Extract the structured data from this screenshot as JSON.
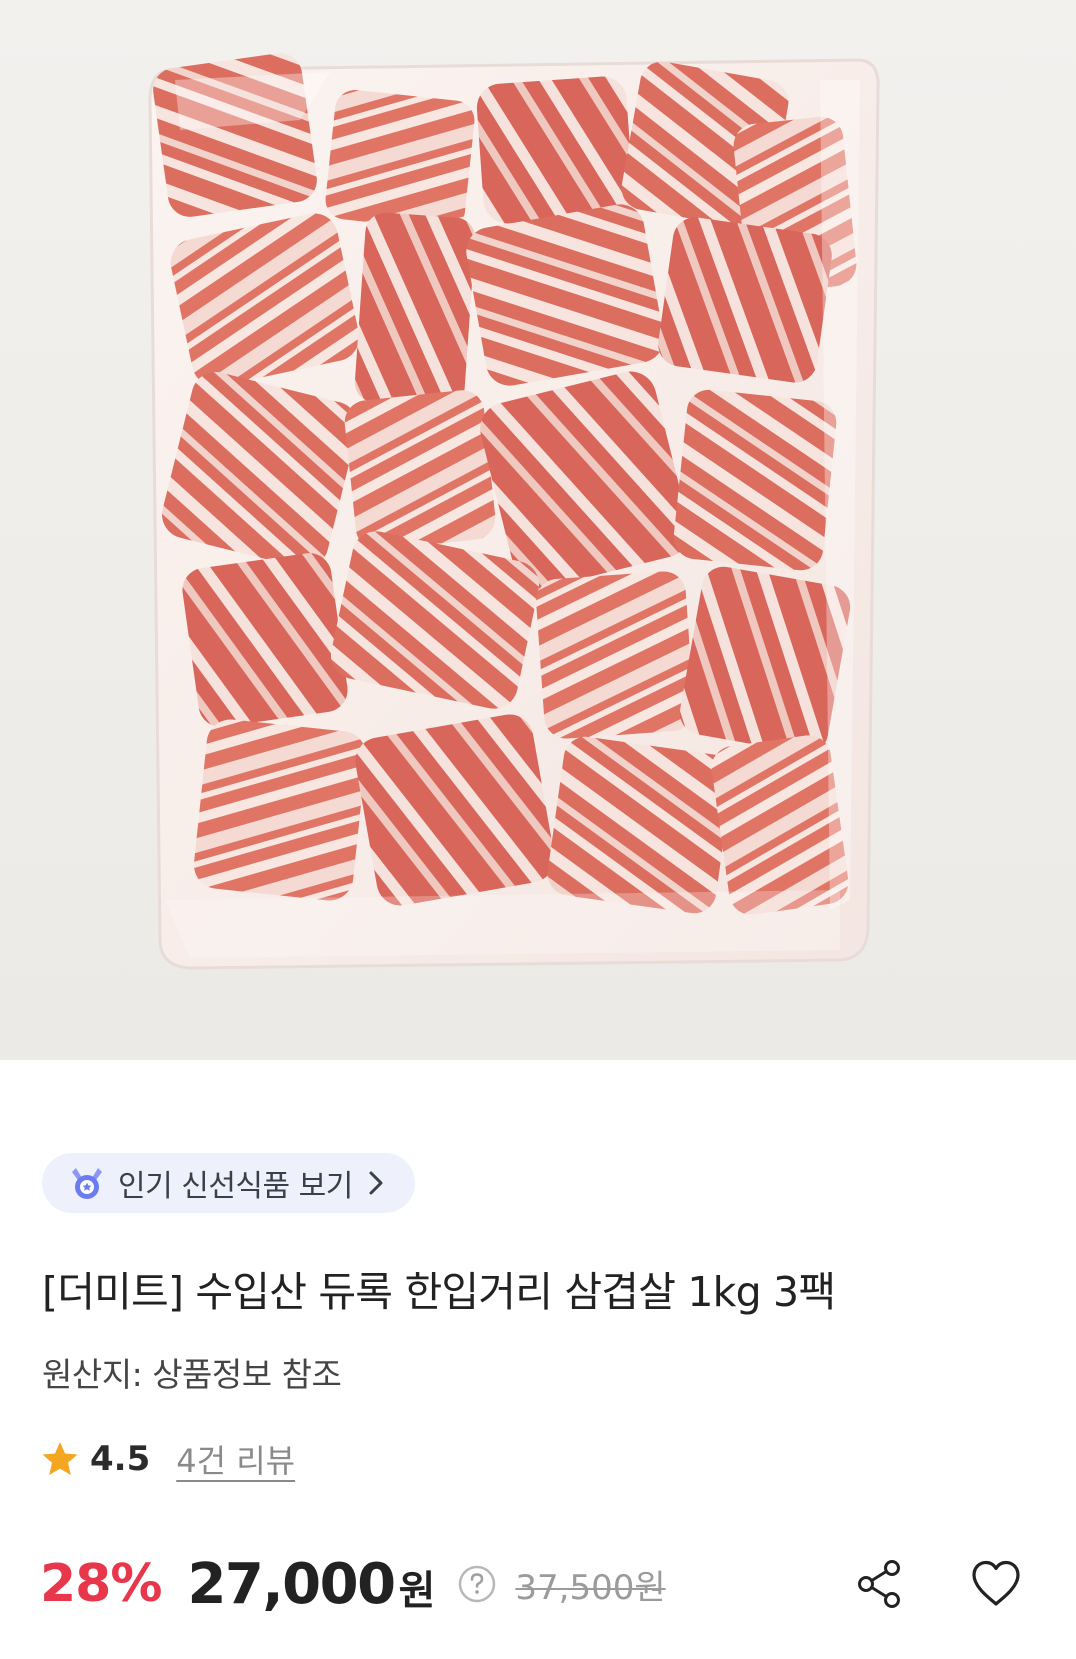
{
  "product_image": {
    "alt": "vacuum-packed pork belly cubes",
    "background_color": "#f1efec",
    "meat_color": "#d96a5c",
    "fat_color": "#f6e3dd"
  },
  "badge": {
    "label": "인기 신선식품 보기",
    "icon": "medal-icon",
    "chevron": "chevron-right-icon",
    "background_color": "#eef1fb",
    "icon_color": "#6b7cf0"
  },
  "product": {
    "title": "[더미트] 수입산 듀록 한입거리 삼겹살 1kg 3팩",
    "origin": "원산지: 상품정보 참조"
  },
  "rating": {
    "value": "4.5",
    "review_link": "4건 리뷰",
    "star_color": "#f4a620"
  },
  "price": {
    "discount": "28%",
    "current": "27,000",
    "unit": "원",
    "original": "37,500원",
    "help_icon": "question-circle-icon",
    "discount_color": "#e8364a"
  },
  "actions": {
    "share_icon": "share-icon",
    "wishlist_icon": "heart-outline-icon"
  }
}
